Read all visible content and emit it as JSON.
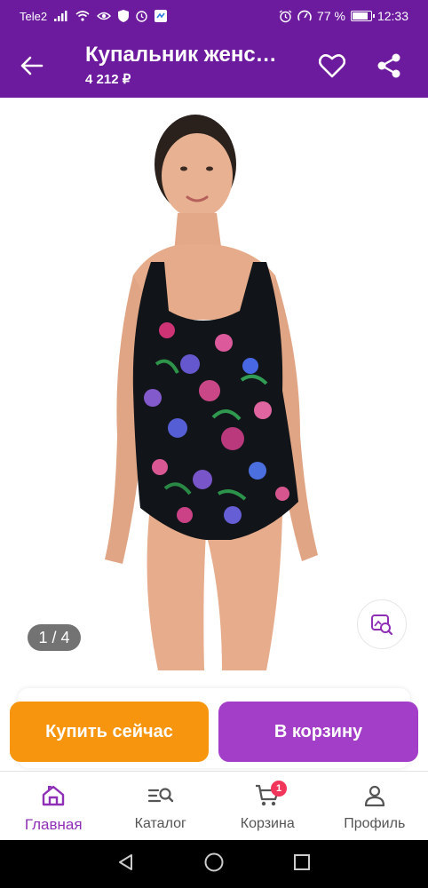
{
  "status_bar": {
    "carrier": "Tele2",
    "battery_percent": "77 %",
    "battery_level": 0.77,
    "time": "12:33"
  },
  "app_bar": {
    "title": "Купальник женс…",
    "price": "4 212 ₽"
  },
  "gallery": {
    "counter": "1 / 4"
  },
  "actions": {
    "buy_now": "Купить сейчас",
    "add_to_cart": "В корзину"
  },
  "bottom_nav": {
    "items": [
      {
        "label": "Главная",
        "icon": "home-icon",
        "active": true
      },
      {
        "label": "Каталог",
        "icon": "catalog-search-icon",
        "active": false
      },
      {
        "label": "Корзина",
        "icon": "cart-icon",
        "active": false,
        "badge": "1"
      },
      {
        "label": "Профиль",
        "icon": "profile-icon",
        "active": false
      }
    ]
  },
  "colors": {
    "brand": "#6d1b9e",
    "buy_now": "#f7950f",
    "cart_button": "#a23ec7",
    "active_nav": "#8e2fb6",
    "badge": "#f2355b"
  }
}
